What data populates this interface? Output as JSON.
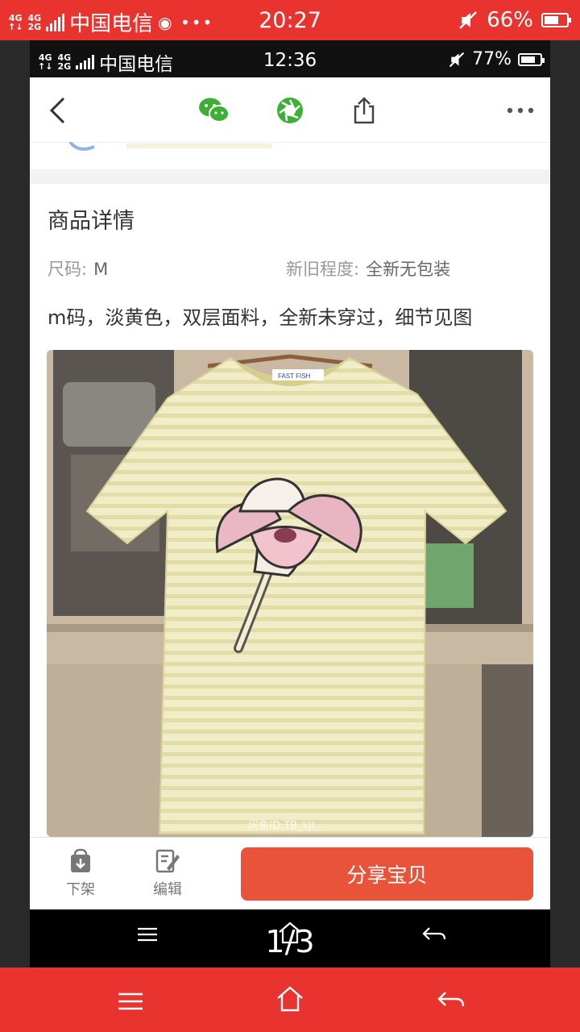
{
  "outer_status": {
    "net_top": "4G",
    "net_mid_top": "4G",
    "net_mid_bottom": "2G",
    "carrier": "中国电信",
    "extra": "◉ •••",
    "time": "20:27",
    "battery_text": "66%",
    "battery_level": 0.66
  },
  "inner_status": {
    "net_top": "4G",
    "net_mid_top": "4G",
    "net_mid_bottom": "2G",
    "carrier": "中国电信",
    "time": "12:36",
    "battery_text": "77%",
    "battery_level": 0.77
  },
  "navbar": {
    "icons": [
      "back-icon",
      "wechat-icon",
      "moments-icon",
      "share-icon",
      "more-icon"
    ]
  },
  "details": {
    "section_title": "商品详情",
    "size_label": "尺码:",
    "size_value": "M",
    "condition_label": "新旧程度:",
    "condition_value": "全新无包装",
    "description": "m码，淡黄色，双层面料，全新未穿过，细节见图"
  },
  "photo": {
    "watermark": "闲鱼ID:TB_kjl",
    "brand_tag": "FAST FISH"
  },
  "bottom_bar": {
    "delist_label": "下架",
    "edit_label": "编辑",
    "share_label": "分享宝贝"
  },
  "page_indicator": "1/3",
  "colors": {
    "outer_red": "#e8332f",
    "share_button": "#e8533a",
    "shirt": "#ece8b8"
  }
}
